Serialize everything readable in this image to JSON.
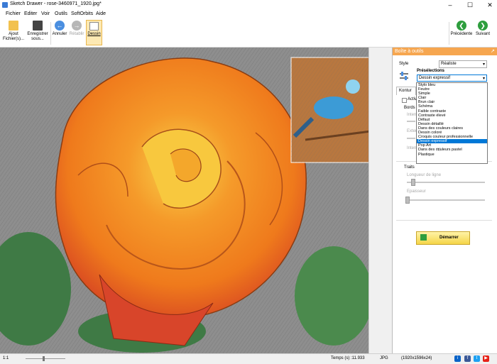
{
  "window": {
    "title": "Sketch Drawer - rose-3460971_1920.jpg*"
  },
  "menu": [
    "Fichier",
    "Editer",
    "Voir",
    "Outils",
    "SoftOrbits",
    "Aide"
  ],
  "toolbar": {
    "add_files": "Ajout\nFichier(s)...",
    "save_as": "Enregistrer\nsous...",
    "undo": "Annuler",
    "redo": "Rétablir",
    "drawing": "Dessin",
    "previous": "Précédente",
    "next": "Suivant"
  },
  "panel": {
    "title": "Boîte à outils",
    "style_label": "Style",
    "style_value": "Réaliste",
    "presets_label": "Présélections",
    "preset_selected": "Dessin expressif",
    "presets": [
      "Stylo bleu",
      "Feutre",
      "Simple",
      "Clair",
      "Brun clair",
      "Schéma",
      "Faible contraste",
      "Contraste élevé",
      "Défaut",
      "Dessin détaillé",
      "Dans des couleurs claires",
      "Dessin coloré",
      "Croquis couleur professionnelle",
      "Dessin expressif",
      "Pop Art",
      "Dans des couleurs pastel",
      "Plastique"
    ],
    "tab_contour": "Kontur",
    "active_label": "Activ",
    "edges_label": "Bords",
    "intensity_label": "Intens",
    "extension_label": "Exten",
    "intensity2_label": "Intens",
    "strokes_label": "Traits",
    "line_length_label": "Longueur de ligne",
    "thickness_label": "Epaisseur",
    "start_button": "Démarrer"
  },
  "status": {
    "zoom": "1:1",
    "time": "Temps (s) :11.933",
    "format": "JPG",
    "dimensions": "(1920x1596x24)"
  }
}
